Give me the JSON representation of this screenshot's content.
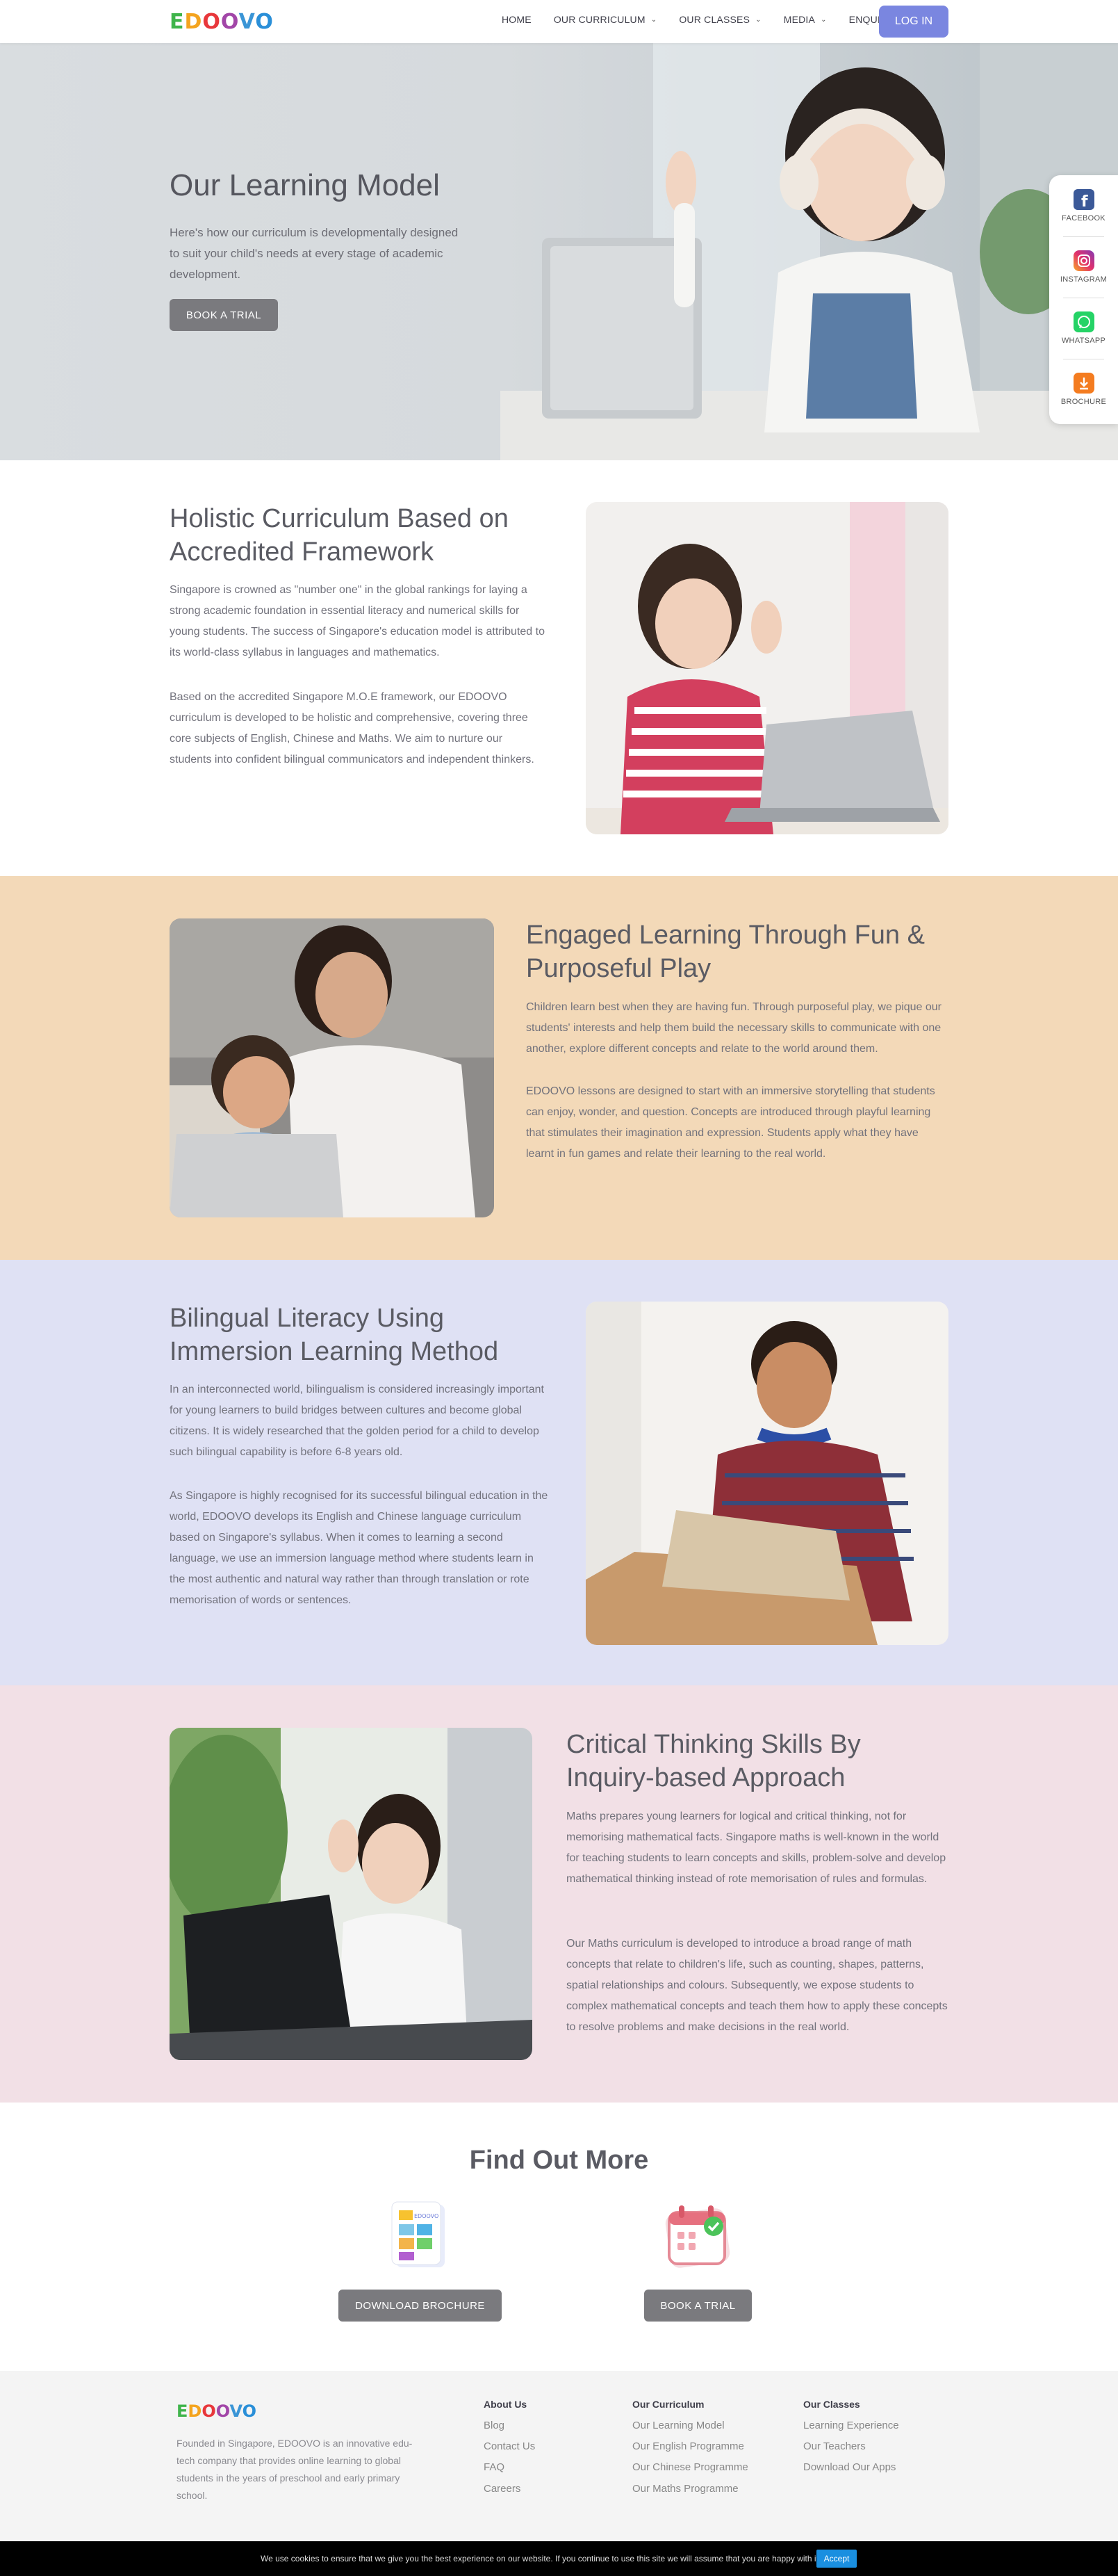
{
  "nav": {
    "logo": "EDOOVO",
    "menu": [
      {
        "label": "HOME",
        "dropdown": false
      },
      {
        "label": "OUR CURRICULUM",
        "dropdown": true
      },
      {
        "label": "OUR CLASSES",
        "dropdown": true
      },
      {
        "label": "MEDIA",
        "dropdown": true
      },
      {
        "label": "ENQUIRY",
        "dropdown": true
      }
    ],
    "login_label": "LOG IN"
  },
  "hero": {
    "title": "Our Learning Model",
    "text": "Here's how our curriculum is developmentally designed to suit your child's needs at every stage of academic development.",
    "button": "BOOK A TRIAL"
  },
  "social": [
    {
      "label": "FACEBOOK",
      "icon": "facebook-icon",
      "color": "#3b5998"
    },
    {
      "label": "INSTAGRAM",
      "icon": "instagram-icon",
      "color": "#c13584"
    },
    {
      "label": "WHATSAPP",
      "icon": "whatsapp-icon",
      "color": "#25d366"
    },
    {
      "label": "BROCHURE",
      "icon": "download-icon",
      "color": "#f47c20"
    }
  ],
  "sections": {
    "holistic": {
      "title": "Holistic Curriculum Based on Accredited Framework",
      "p1": "Singapore is crowned as \"number one\" in the global rankings for laying a strong academic foundation in essential literacy and numerical skills for young students. The success of Singapore's education model is attributed to its world-class syllabus in languages and mathematics.",
      "p2": "Based on the accredited Singapore M.O.E framework, our EDOOVO curriculum is developed to be holistic and comprehensive, covering three core subjects of English, Chinese and Maths. We aim to nurture our students into confident bilingual communicators and independent thinkers."
    },
    "engaged": {
      "title": "Engaged Learning Through Fun & Purposeful Play",
      "p1": "Children learn best when they are having fun. Through purposeful play, we pique our students' interests and help them build the necessary skills to communicate with one another, explore different concepts and relate to the world around them.",
      "p2": "EDOOVO lessons are designed to start with an immersive storytelling that students can enjoy, wonder, and question. Concepts are introduced through playful learning that stimulates their imagination and expression. Students apply what they have learnt in fun games and relate their learning to the real world.",
      "bg": "#f3d9b8"
    },
    "bilingual": {
      "title": "Bilingual Literacy Using Immersion Learning Method",
      "p1": "In an interconnected world, bilingualism is considered increasingly important for young learners to build bridges between cultures and become global citizens. It is widely researched that the golden period for a child to develop such bilingual capability is before 6-8 years old.",
      "p2": "As Singapore is highly recognised for its successful bilingual education in the world, EDOOVO develops its English and Chinese language curriculum based on Singapore's syllabus. When it comes to learning a second language, we use an immersion language method where students learn in the most authentic and natural way rather than through translation or rote memorisation of words or sentences.",
      "bg": "#dfe1f4"
    },
    "critical": {
      "title": "Critical Thinking Skills By Inquiry-based Approach",
      "p1": "Maths prepares young learners for logical and critical thinking, not for memorising mathematical facts. Singapore maths is well-known in the world for teaching students to learn concepts and skills, problem-solve and develop mathematical thinking instead of rote memorisation of rules and formulas.",
      "p2": "Our Maths curriculum is developed to introduce a broad range of math concepts that relate to children's life, such as counting, shapes, patterns, spatial relationships and colours. Subsequently, we expose students to complex mathematical concepts and teach them how to apply these concepts to resolve problems and make decisions in the real world.",
      "bg": "#f2e0e6"
    }
  },
  "find_out_more": {
    "title": "Find Out More",
    "brochure_button": "DOWNLOAD BROCHURE",
    "trial_button": "BOOK A TRIAL",
    "brochure_icon_text": "EDOOVO"
  },
  "footer": {
    "logo": "EDOOVO",
    "about_text": "Founded in Singapore, EDOOVO is an innovative edu-tech company that provides online learning to global students in the years of preschool and early primary school.",
    "columns": [
      {
        "title": "About Us",
        "links": [
          "Blog",
          "Contact Us",
          "FAQ",
          "Careers"
        ]
      },
      {
        "title": "Our Curriculum",
        "links": [
          "Our Learning Model",
          "Our English Programme",
          "Our Chinese Programme",
          "Our Maths Programme"
        ]
      },
      {
        "title": "Our Classes",
        "links": [
          "Learning Experience",
          "Our Teachers",
          "Download Our Apps"
        ]
      }
    ]
  },
  "cookie": {
    "text": "We use cookies to ensure that we give you the best experience on our website. If you continue to use this site we will assume that you are happy with it.",
    "accept": "Accept"
  },
  "colors": {
    "accent": "#7a86e0",
    "button_gray": "#7a7a7e"
  }
}
